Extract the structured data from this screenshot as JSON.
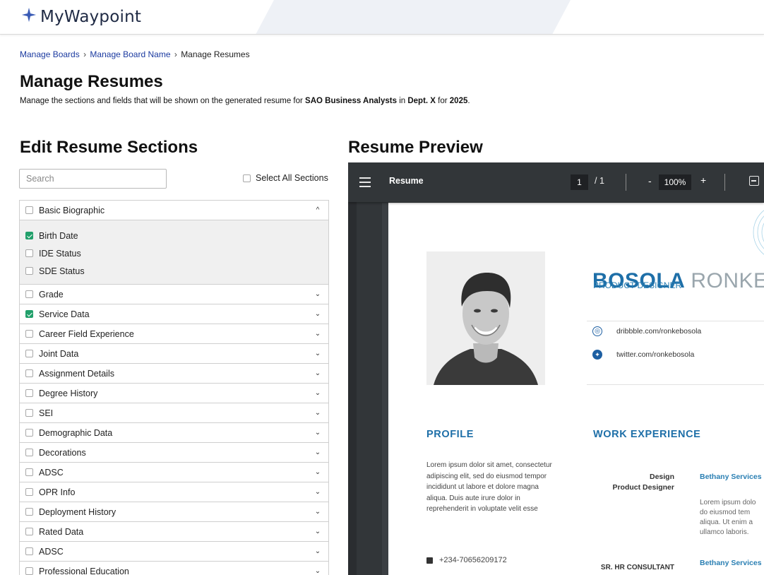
{
  "brand": {
    "name": "MyWaypoint"
  },
  "breadcrumb": [
    {
      "label": "Manage Boards"
    },
    {
      "label": "Manage Board Name"
    },
    {
      "label": "Manage Resumes"
    }
  ],
  "breadcrumb_sep": "›",
  "page": {
    "title": "Manage Resumes",
    "subtitle_prefix": "Manage the sections and fields that will be shown on the generated resume for ",
    "subtitle_group": "SAO Business Analysts",
    "subtitle_in": " in ",
    "subtitle_dept": "Dept. X",
    "subtitle_for": " for ",
    "subtitle_year": "2025",
    "subtitle_end": "."
  },
  "editor": {
    "heading": "Edit Resume Sections",
    "search_placeholder": "Search",
    "select_all_label": "Select All Sections",
    "expanded_section": {
      "label": "Basic Biographic",
      "checked": false,
      "chevron": "^",
      "fields": [
        {
          "label": "Birth Date",
          "checked": true
        },
        {
          "label": "IDE Status",
          "checked": false
        },
        {
          "label": "SDE Status",
          "checked": false
        }
      ]
    },
    "sections": [
      {
        "label": "Grade",
        "checked": false
      },
      {
        "label": "Service Data",
        "checked": true
      },
      {
        "label": "Career Field Experience",
        "checked": false
      },
      {
        "label": "Joint Data",
        "checked": false
      },
      {
        "label": "Assignment Details",
        "checked": false
      },
      {
        "label": "Degree History",
        "checked": false
      },
      {
        "label": "SEI",
        "checked": false
      },
      {
        "label": "Demographic Data",
        "checked": false
      },
      {
        "label": "Decorations",
        "checked": false
      },
      {
        "label": "ADSC",
        "checked": false
      },
      {
        "label": "OPR Info",
        "checked": false
      },
      {
        "label": "Deployment History",
        "checked": false
      },
      {
        "label": "Rated Data",
        "checked": false
      },
      {
        "label": "ADSC",
        "checked": false
      },
      {
        "label": "Professional Education",
        "checked": false
      }
    ],
    "collapsed_chevron": "⌄"
  },
  "preview": {
    "heading": "Resume Preview",
    "toolbar": {
      "title": "Resume",
      "current_page": "1",
      "total_pages": "/ 1",
      "zoom": "100%",
      "minus": "-",
      "plus": "+"
    },
    "resume": {
      "first_name": "BOSOLA",
      "last_name": "RONKE",
      "role": "PRODUCT DESIGNER",
      "dribbble": "dribbble.com/ronkebosola",
      "twitter": "twitter.com/ronkebosola",
      "profile_heading": "PROFILE",
      "profile_text": "Lorem ipsum dolor sit amet, consectetur adipiscing elit, sed do eiusmod tempor incididunt ut labore et dolore magna aliqua. Duis aute irure dolor in reprehenderit in voluptate velit esse",
      "phone": "+234-70656209172",
      "work_heading": "WORK EXPERIENCE",
      "jobs": [
        {
          "title_line1": "Design",
          "title_line2": "Product Designer",
          "company": "Bethany Services",
          "desc_lines": [
            "Lorem ipsum dolo",
            "do eiusmod tem",
            "aliqua. Ut enim a",
            "ullamco laboris."
          ]
        },
        {
          "title_line1": "SR. HR CONSULTANT",
          "company": "Bethany Services"
        }
      ]
    }
  },
  "colors": {
    "brand_star": "#3a5bb5",
    "link": "#1b3aa0",
    "check_green": "#22a06b",
    "resume_blue": "#1e6fa8",
    "viewer_bg": "#323639"
  }
}
